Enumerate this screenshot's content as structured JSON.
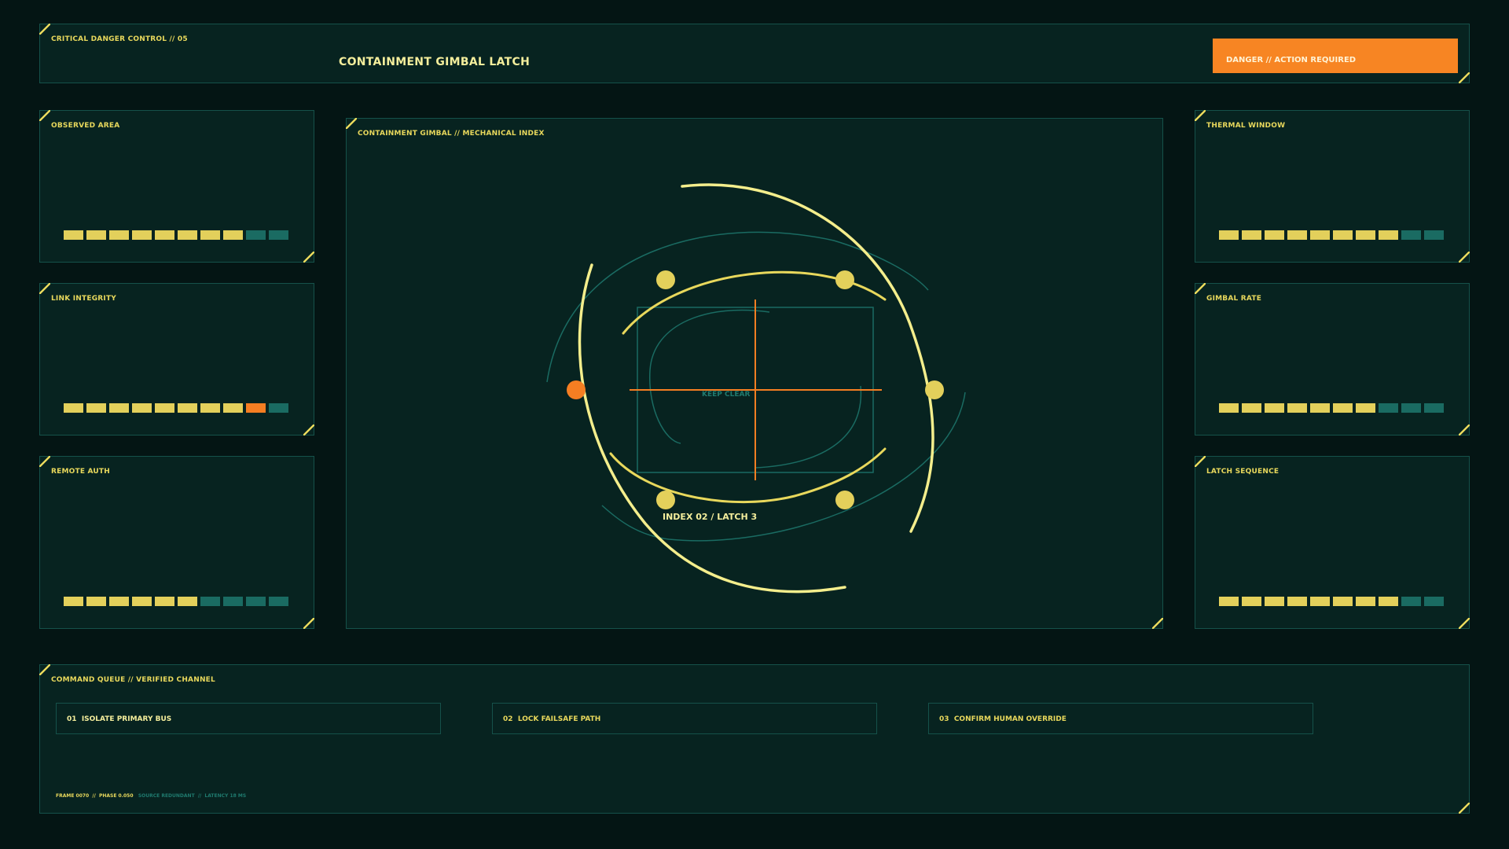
{
  "header": {
    "label": "CRITICAL DANGER CONTROL // 05",
    "title": "CONTAINMENT GIMBAL LATCH",
    "badge": "DANGER // ACTION REQUIRED"
  },
  "left_panels": [
    {
      "label": "OBSERVED AREA",
      "levels": [
        "on",
        "on",
        "on",
        "on",
        "on",
        "on",
        "on",
        "on",
        "off",
        "off"
      ]
    },
    {
      "label": "LINK INTEGRITY",
      "levels": [
        "on",
        "on",
        "on",
        "on",
        "on",
        "on",
        "on",
        "on",
        "alert",
        "off"
      ]
    },
    {
      "label": "REMOTE AUTH",
      "levels": [
        "on",
        "on",
        "on",
        "on",
        "on",
        "on",
        "off",
        "off",
        "off",
        "off"
      ]
    }
  ],
  "right_panels": [
    {
      "label": "THERMAL WINDOW",
      "levels": [
        "on",
        "on",
        "on",
        "on",
        "on",
        "on",
        "on",
        "on",
        "off",
        "off"
      ]
    },
    {
      "label": "GIMBAL RATE",
      "levels": [
        "on",
        "on",
        "on",
        "on",
        "on",
        "on",
        "on",
        "off",
        "off",
        "off"
      ]
    },
    {
      "label": "LATCH SEQUENCE",
      "levels": [
        "on",
        "on",
        "on",
        "on",
        "on",
        "on",
        "on",
        "on",
        "off",
        "off"
      ]
    }
  ],
  "gimbal": {
    "label": "CONTAINMENT GIMBAL // MECHANICAL INDEX",
    "keep_clear": "KEEP CLEAR",
    "index_label": "INDEX 02 / LATCH 3"
  },
  "commands": {
    "label": "COMMAND QUEUE // VERIFIED CHANNEL",
    "items": [
      {
        "num": "01",
        "text": "ISOLATE PRIMARY BUS"
      },
      {
        "num": "02",
        "text": "LOCK FAILSAFE PATH"
      },
      {
        "num": "03",
        "text": "CONFIRM HUMAN OVERRIDE"
      }
    ]
  },
  "footer": {
    "frame": "FRAME 0070",
    "phase": "PHASE 0.050",
    "source": "SOURCE REDUNDANT",
    "latency": "LATENCY 18 MS"
  },
  "colors": {
    "accent": "#e8d85c",
    "danger": "#f78523",
    "bar_off": "#1a6b62",
    "panel": "#072320",
    "border": "#15514a"
  }
}
